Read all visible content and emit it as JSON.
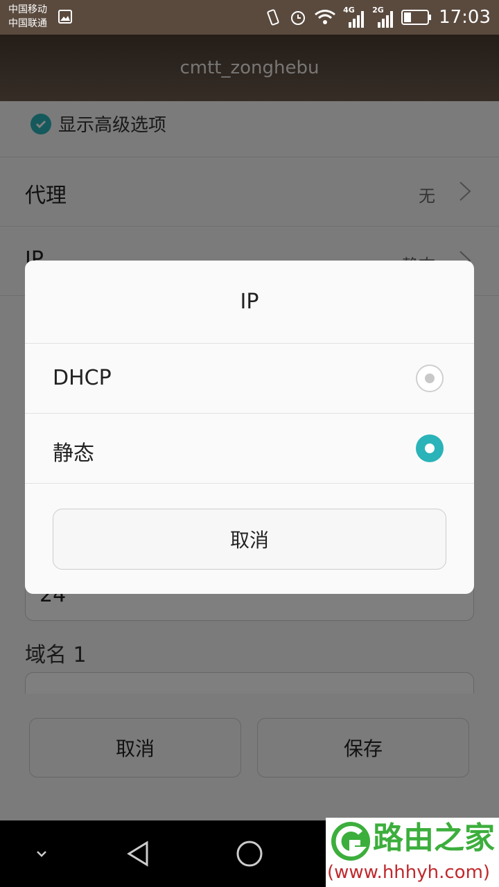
{
  "status_bar": {
    "carrier1": "中国移动",
    "carrier2": "中国联通",
    "net1": "4G",
    "net2": "2G",
    "time": "17:03"
  },
  "app_bar": {
    "title": "cmtt_zonghebu"
  },
  "settings": {
    "advanced_label": "显示高级选项",
    "advanced_checked": true,
    "proxy_label": "代理",
    "proxy_value": "无",
    "ip_label": "IP",
    "ip_value": "静态",
    "prefix_value": "24",
    "domain1_label": "域名 1"
  },
  "footer_buttons": {
    "cancel": "取消",
    "save": "保存"
  },
  "dialog": {
    "title": "IP",
    "options": [
      {
        "label": "DHCP",
        "selected": false
      },
      {
        "label": "静态",
        "selected": true
      }
    ],
    "cancel": "取消"
  },
  "watermark": {
    "name": "路由之家",
    "url": "(www.hhhyh.com)"
  },
  "colors": {
    "accent": "#2ab3b8",
    "watermark_green": "#3cae3c",
    "watermark_red": "#c0282d"
  }
}
